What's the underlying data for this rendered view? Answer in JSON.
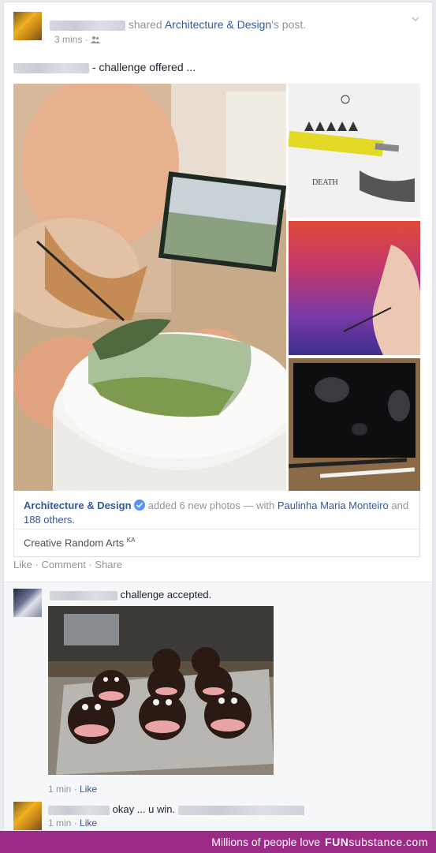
{
  "post": {
    "shared_text": "shared",
    "page_name": "Architecture & Design",
    "post_suffix": "'s post.",
    "timestamp": "3 mins",
    "audience_icon": "friends-icon",
    "body_suffix": "- challenge offered ..."
  },
  "attachment": {
    "page_name": "Architecture & Design",
    "verified_icon": "verified-badge-icon",
    "added_text": "added 6 new photos — with",
    "tagged_name": "Paulinha Maria Monteiro",
    "and_text": "and",
    "others_text": "188 others.",
    "credit": "Creative Random Arts",
    "credit_sup": "KA"
  },
  "actions": {
    "like": "Like",
    "comment": "Comment",
    "share": "Share",
    "sep": "·"
  },
  "comments": [
    {
      "text": "challenge accepted.",
      "time": "1 min",
      "like": "Like"
    },
    {
      "text": "okay ... u win.",
      "time": "1 min",
      "like": "Like"
    }
  ],
  "footer": {
    "text": "Millions of people love",
    "brand_fun": "FUN",
    "brand_sub": "substance",
    "brand_tld": ".com"
  },
  "colors": {
    "link_blue": "#365899",
    "footer_purple": "#9b2b86"
  }
}
